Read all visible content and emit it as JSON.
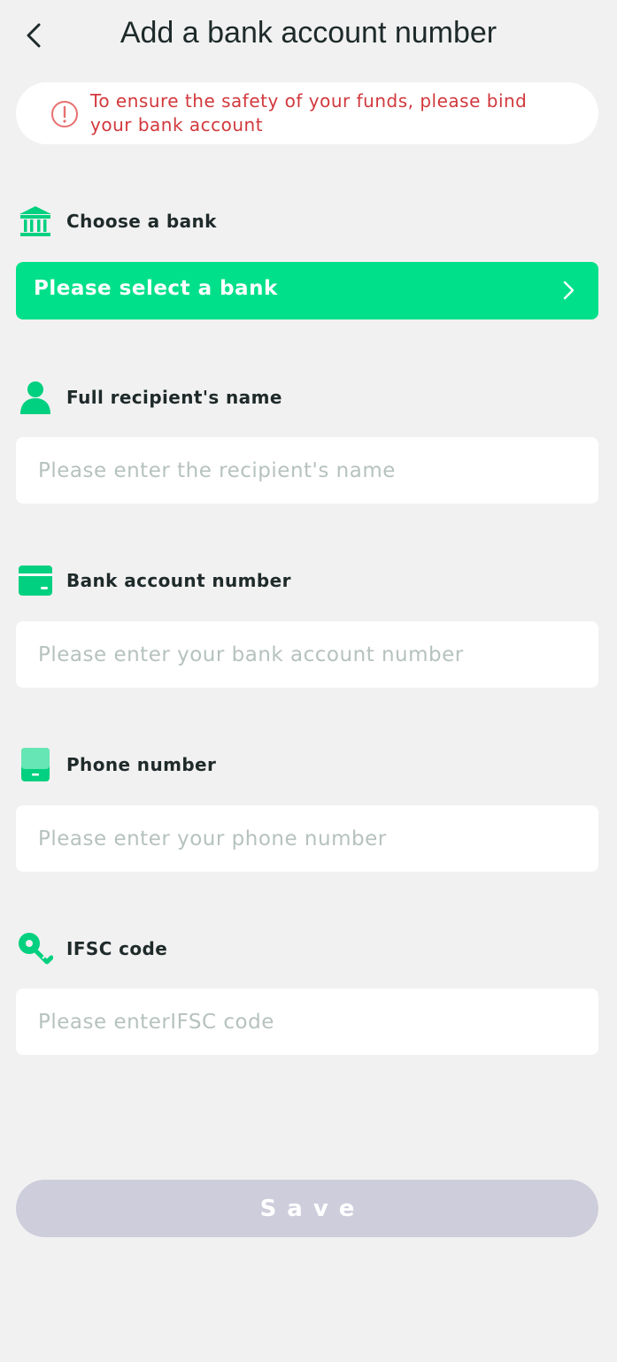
{
  "header": {
    "title": "Add a bank account number",
    "back_icon": "chevron-left-icon"
  },
  "notice": {
    "text": "To ensure the safety of your funds, please bind your bank account",
    "icon": "exclamation-circle-icon"
  },
  "form": {
    "bank": {
      "label": "Choose a bank",
      "icon": "bank-icon",
      "select_text": "Please select a bank"
    },
    "name": {
      "label": "Full recipient's name",
      "icon": "user-icon",
      "placeholder": "Please enter the recipient's name",
      "value": ""
    },
    "account": {
      "label": "Bank account number",
      "icon": "card-icon",
      "placeholder": "Please enter your bank account number",
      "value": ""
    },
    "phone": {
      "label": "Phone number",
      "icon": "phone-icon",
      "placeholder": "Please enter your phone number",
      "value": ""
    },
    "ifsc": {
      "label": "IFSC code",
      "icon": "key-icon",
      "placeholder": "Please enterIFSC code",
      "value": ""
    }
  },
  "save_label": "Save",
  "colors": {
    "accent": "#00e08a",
    "warning": "#d2383c",
    "disabled": "#cecddc"
  }
}
